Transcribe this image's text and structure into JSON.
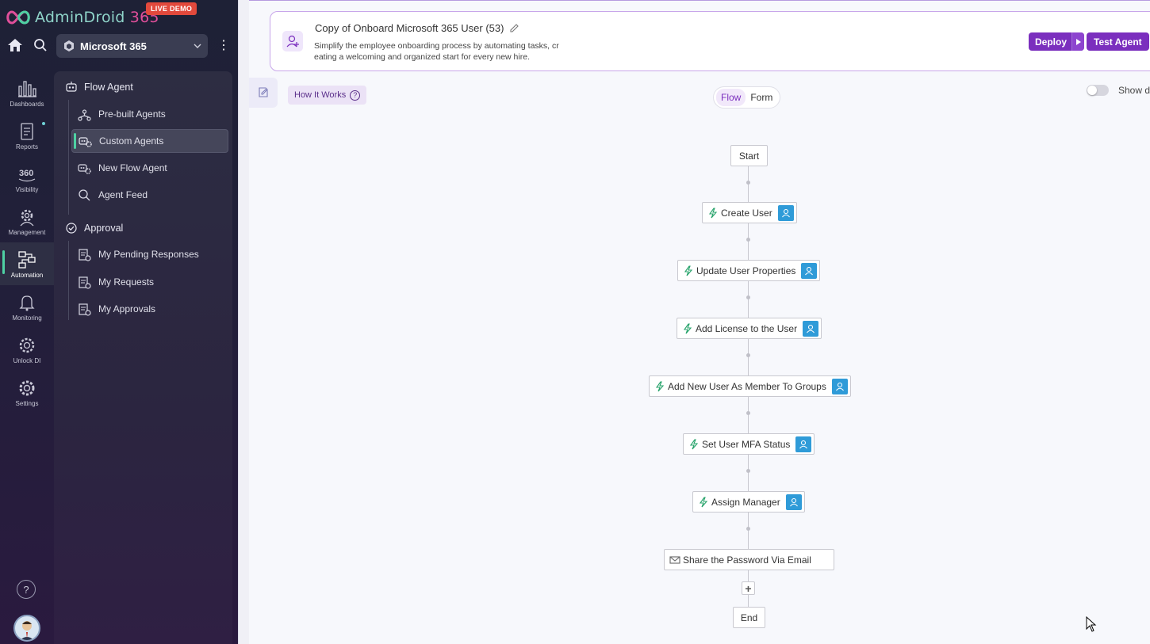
{
  "brand": {
    "name_main": "AdminDroid",
    "name_num": " 365",
    "badge": "LIVE DEMO"
  },
  "tenant": {
    "name": "Microsoft 365"
  },
  "nav": {
    "items": [
      {
        "label": "Dashboards",
        "icon": "dashboard-icon"
      },
      {
        "label": "Reports",
        "icon": "reports-icon"
      },
      {
        "label": "Visibility",
        "icon": "360-visibility-icon"
      },
      {
        "label": "Management",
        "icon": "management-gear-icon"
      },
      {
        "label": "Automation",
        "icon": "automation-icon",
        "active": true
      },
      {
        "label": "Monitoring",
        "icon": "monitoring-bell-icon"
      },
      {
        "label": "Unlock DI",
        "icon": "unlock-icon"
      },
      {
        "label": "Settings",
        "icon": "settings-gear-icon"
      }
    ]
  },
  "submenu": {
    "flow_agent": "Flow Agent",
    "prebuilt": "Pre-built Agents",
    "custom": "Custom Agents",
    "new_flow": "New Flow Agent",
    "feed": "Agent Feed",
    "approval": "Approval",
    "pending": "My Pending Responses",
    "requests": "My Requests",
    "approvals": "My Approvals"
  },
  "help": {
    "symbol": "?"
  },
  "header": {
    "title": "Copy of Onboard Microsoft 365 User (53)",
    "description_line1": "Simplify the employee onboarding process by automating tasks, cr",
    "description_line2": "eating a welcoming and organized start for every new hire.",
    "deploy": "Deploy",
    "test": "Test Agent"
  },
  "toolbar": {
    "how": "How It Works",
    "q": "?",
    "flow": "Flow",
    "form": "Form",
    "show": "Show d"
  },
  "flow": {
    "start": "Start",
    "end": "End",
    "plus": "+",
    "steps": [
      "Create User",
      "Update User Properties",
      "Add License to the User",
      "Add New User As Member To Groups",
      "Set User MFA Status",
      "Assign Manager",
      "Share the Password Via Email"
    ]
  },
  "colors": {
    "accent": "#7b2fbe",
    "approver": "#2f9bd8",
    "active_bar": "#4ed1a3",
    "bolt": "#27a36b"
  }
}
